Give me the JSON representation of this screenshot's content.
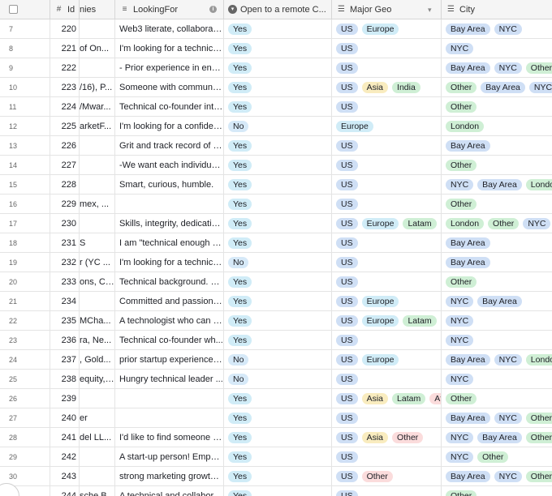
{
  "colors": {
    "blue": "#cfdff5",
    "yes": "#d0ecf7",
    "green": "#cfefd5",
    "yellow": "#f9ecbf",
    "red": "#fbdcdc",
    "lightblue": "#d6e9f8"
  },
  "header": {
    "companies_label": "nies",
    "id_label": "Id",
    "lookingfor_label": "LookingFor",
    "remote_label": "Open to a remote C...",
    "geo_label": "Major Geo",
    "city_label": "City"
  },
  "rows": [
    {
      "rn": "7",
      "id": "220",
      "company": "",
      "looking": "Web3 literate, collaborati...",
      "remote": "Yes",
      "geo": [
        "US",
        "Europe"
      ],
      "city": [
        "Bay Area",
        "NYC"
      ]
    },
    {
      "rn": "8",
      "id": "221",
      "company": "of On...",
      "looking": "I'm looking for a technical...",
      "remote": "Yes",
      "geo": [
        "US"
      ],
      "city": [
        "NYC"
      ]
    },
    {
      "rn": "9",
      "id": "222",
      "company": "",
      "looking": "- Prior experience in engi...",
      "remote": "Yes",
      "geo": [
        "US"
      ],
      "city": [
        "Bay Area",
        "NYC",
        "Other"
      ]
    },
    {
      "rn": "10",
      "id": "223",
      "company": "/16), P...",
      "looking": "Someone with community...",
      "remote": "Yes",
      "geo": [
        "US",
        "Asia",
        "India"
      ],
      "city": [
        "Other",
        "Bay Area",
        "NYC"
      ]
    },
    {
      "rn": "11",
      "id": "224",
      "company": "/Mwar...",
      "looking": "Technical co-founder inte...",
      "remote": "Yes",
      "geo": [
        "US"
      ],
      "city": [
        "Other"
      ]
    },
    {
      "rn": "12",
      "id": "225",
      "company": "arketF...",
      "looking": "I'm looking for a confiden...",
      "remote": "No",
      "geo": [
        "Europe"
      ],
      "city": [
        "London"
      ]
    },
    {
      "rn": "13",
      "id": "226",
      "company": "",
      "looking": "Grit and track record of b...",
      "remote": "Yes",
      "geo": [
        "US"
      ],
      "city": [
        "Bay Area"
      ]
    },
    {
      "rn": "14",
      "id": "227",
      "company": "",
      "looking": "-We want each individual ...",
      "remote": "Yes",
      "geo": [
        "US"
      ],
      "city": [
        "Other"
      ]
    },
    {
      "rn": "15",
      "id": "228",
      "company": "",
      "looking": "Smart, curious, humble.",
      "remote": "Yes",
      "geo": [
        "US"
      ],
      "city": [
        "NYC",
        "Bay Area",
        "London"
      ]
    },
    {
      "rn": "16",
      "id": "229",
      "company": "mex, ...",
      "looking": "",
      "remote": "Yes",
      "geo": [
        "US"
      ],
      "city": [
        "Other"
      ]
    },
    {
      "rn": "17",
      "id": "230",
      "company": "",
      "looking": "Skills, integrity, dedicatio...",
      "remote": "Yes",
      "geo": [
        "US",
        "Europe",
        "Latam",
        "A"
      ],
      "city": [
        "London",
        "Other",
        "NYC"
      ]
    },
    {
      "rn": "18",
      "id": "231",
      "company": "S",
      "looking": "I am \"technical enough to...",
      "remote": "Yes",
      "geo": [
        "US"
      ],
      "city": [
        "Bay Area"
      ]
    },
    {
      "rn": "19",
      "id": "232",
      "company": "r (YC ...",
      "looking": "I'm looking for a technical...",
      "remote": "No",
      "geo": [
        "US"
      ],
      "city": [
        "Bay Area"
      ]
    },
    {
      "rn": "20",
      "id": "233",
      "company": "ons, Ct...",
      "looking": "Technical background. C...",
      "remote": "Yes",
      "geo": [
        "US"
      ],
      "city": [
        "Other"
      ]
    },
    {
      "rn": "21",
      "id": "234",
      "company": "",
      "looking": "Committed and passionat...",
      "remote": "Yes",
      "geo": [
        "US",
        "Europe"
      ],
      "city": [
        "NYC",
        "Bay Area"
      ]
    },
    {
      "rn": "22",
      "id": "235",
      "company": "MCha...",
      "looking": "A technologist who can m...",
      "remote": "Yes",
      "geo": [
        "US",
        "Europe",
        "Latam"
      ],
      "city": [
        "NYC"
      ]
    },
    {
      "rn": "23",
      "id": "236",
      "company": "ra, Ne...",
      "looking": "Technical co-founder wh...",
      "remote": "Yes",
      "geo": [
        "US"
      ],
      "city": [
        "NYC"
      ]
    },
    {
      "rn": "24",
      "id": "237",
      "company": ", Gold...",
      "looking": "prior startup experience e...",
      "remote": "No",
      "geo": [
        "US",
        "Europe"
      ],
      "city": [
        "Bay Area",
        "NYC",
        "London"
      ]
    },
    {
      "rn": "25",
      "id": "238",
      "company": "equity, ...",
      "looking": "Hungry technical leader ...",
      "remote": "No",
      "geo": [
        "US"
      ],
      "city": [
        "NYC"
      ]
    },
    {
      "rn": "26",
      "id": "239",
      "company": "",
      "looking": "",
      "remote": "Yes",
      "geo": [
        "US",
        "Asia",
        "Latam",
        "Afric"
      ],
      "city": [
        "Other"
      ]
    },
    {
      "rn": "27",
      "id": "240",
      "company": "er",
      "looking": "",
      "remote": "Yes",
      "geo": [
        "US"
      ],
      "city": [
        "Bay Area",
        "NYC",
        "Other"
      ]
    },
    {
      "rn": "28",
      "id": "241",
      "company": "del LL...",
      "looking": "I'd like to find someone w...",
      "remote": "Yes",
      "geo": [
        "US",
        "Asia",
        "Other"
      ],
      "city": [
        "NYC",
        "Bay Area",
        "Other"
      ]
    },
    {
      "rn": "29",
      "id": "242",
      "company": "",
      "looking": "A start-up person! Empha...",
      "remote": "Yes",
      "geo": [
        "US"
      ],
      "city": [
        "NYC",
        "Other"
      ]
    },
    {
      "rn": "30",
      "id": "243",
      "company": "",
      "looking": "strong marketing growth ...",
      "remote": "Yes",
      "geo": [
        "US",
        "Other"
      ],
      "city": [
        "Bay Area",
        "NYC",
        "Other"
      ]
    },
    {
      "rn": "",
      "id": "244",
      "company": "sche B...",
      "looking": "A technical and collabora...",
      "remote": "Yes",
      "geo": [
        "US"
      ],
      "city": [
        "Other"
      ]
    }
  ]
}
